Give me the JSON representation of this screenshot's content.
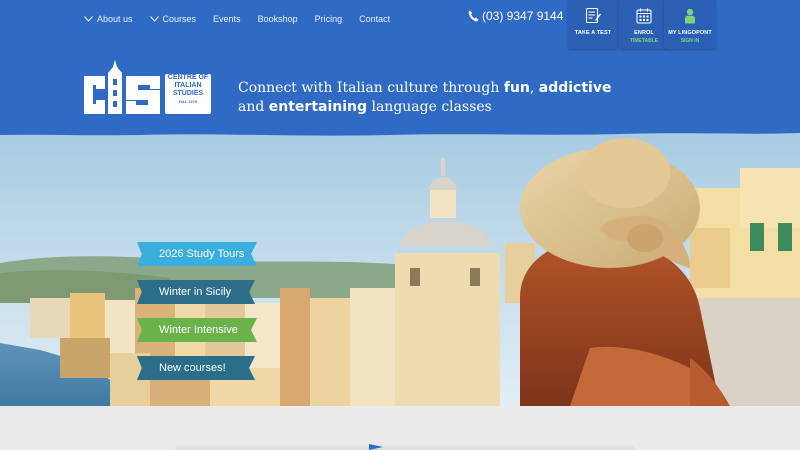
{
  "nav": {
    "items": [
      {
        "label": "About us",
        "has_dropdown": true
      },
      {
        "label": "Courses",
        "has_dropdown": true
      },
      {
        "label": "Events",
        "has_dropdown": false
      },
      {
        "label": "Bookshop",
        "has_dropdown": false
      },
      {
        "label": "Pricing",
        "has_dropdown": false
      },
      {
        "label": "Contact",
        "has_dropdown": false
      }
    ],
    "phone": "(03) 9347 9144"
  },
  "top_boxes": [
    {
      "label": "TAKE A TEST",
      "sub": "",
      "icon": "test-icon"
    },
    {
      "label": "ENROL",
      "sub": "TIMETABLE",
      "icon": "calendar-icon"
    },
    {
      "label": "MY LINGOPONT",
      "sub": "SIGN IN",
      "icon": "user-icon"
    }
  ],
  "logo": {
    "initials": "CIS",
    "line1": "CENTRE OF",
    "line2": "ITALIAN",
    "line3": "STUDIES",
    "since": "DAL 1979"
  },
  "tagline": {
    "part1": "Connect with Italian culture through ",
    "bold1": "fun",
    "part2": ", ",
    "bold2": "addictive",
    "part3": "and ",
    "bold3": "entertaining",
    "part4": " language classes"
  },
  "banners": [
    {
      "label": "2026 Study Tours"
    },
    {
      "label": "Winter in Sicily"
    },
    {
      "label": "Winter Intensive"
    },
    {
      "label": "New courses!"
    }
  ],
  "colors": {
    "header_blue": "#2f6bc5",
    "box_blue": "#2a5fb3",
    "banner_light_blue": "#3aaedc",
    "banner_teal": "#2c6e8a",
    "banner_green": "#6ab24a",
    "sub_green": "#7ed37e"
  }
}
